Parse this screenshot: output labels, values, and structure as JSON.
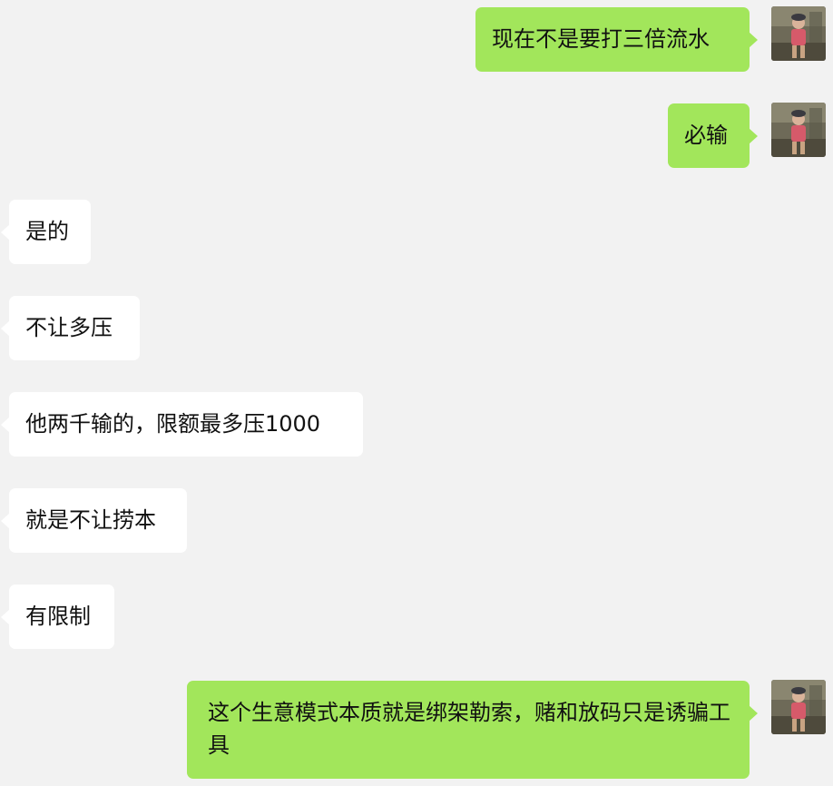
{
  "colors": {
    "background": "#f2f2f2",
    "sent_bubble": "#a2e65b",
    "received_bubble": "#ffffff",
    "text": "#111111"
  },
  "avatar_icon": "user-photo-avatar",
  "messages": [
    {
      "side": "sent",
      "text": "现在不是要打三倍流水"
    },
    {
      "side": "sent",
      "text": "必输"
    },
    {
      "side": "received",
      "text": "是的"
    },
    {
      "side": "received",
      "text": "不让多压"
    },
    {
      "side": "received",
      "text": "他两千输的，限额最多压1000"
    },
    {
      "side": "received",
      "text": "就是不让捞本"
    },
    {
      "side": "received",
      "text": "有限制"
    },
    {
      "side": "sent",
      "text": "这个生意模式本质就是绑架勒索，赌和放码只是诱骗工具"
    }
  ]
}
